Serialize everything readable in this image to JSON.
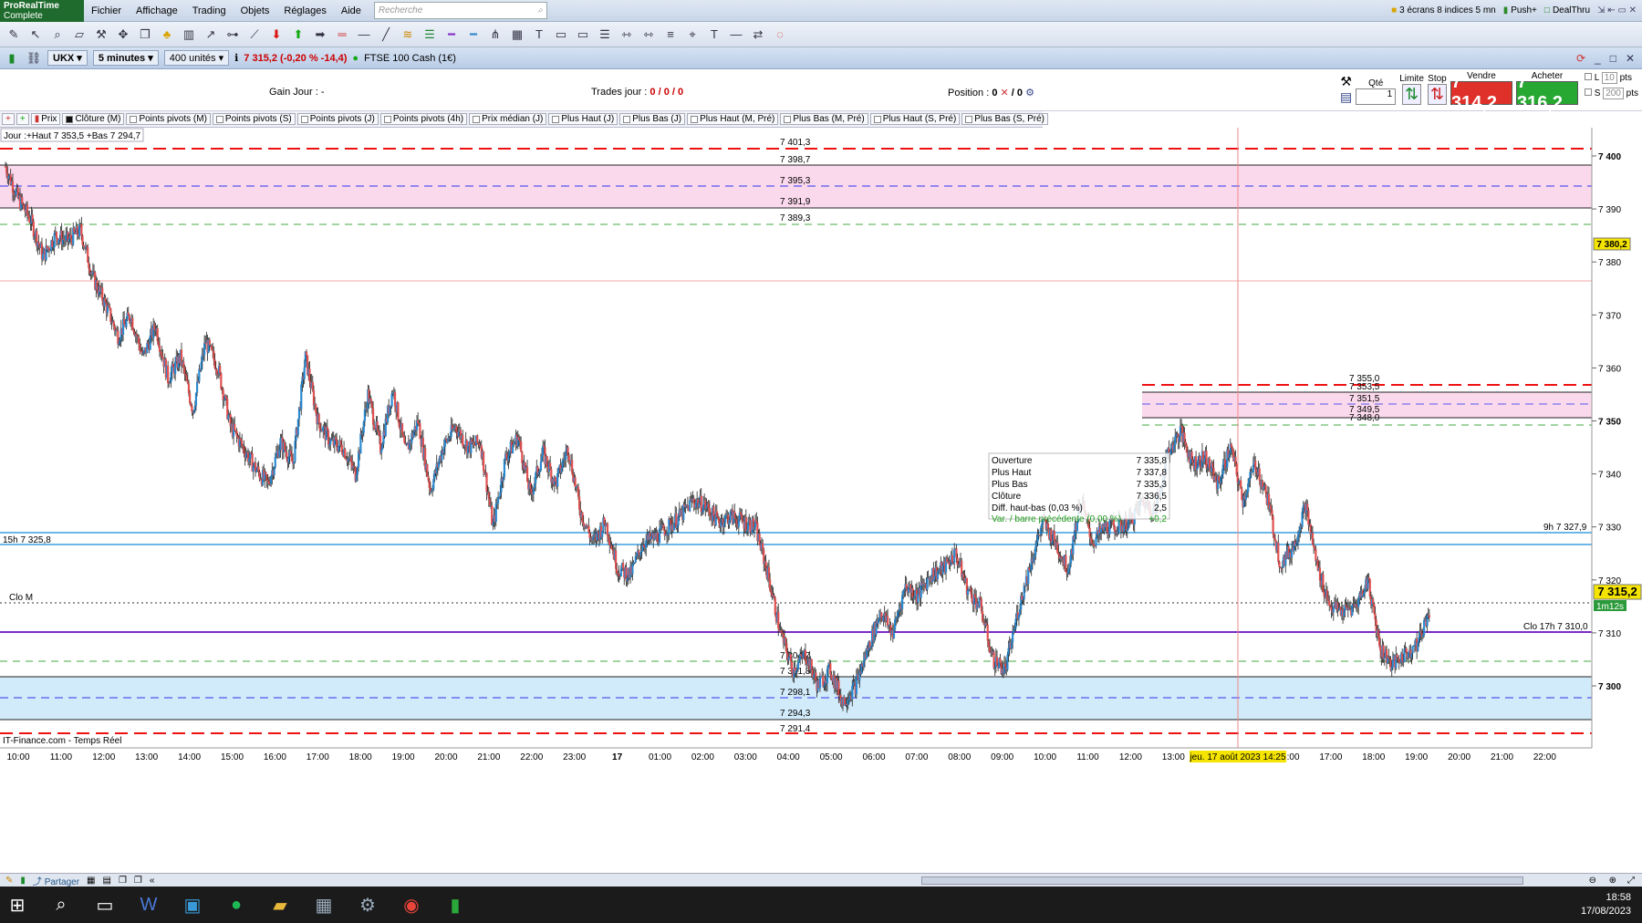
{
  "menubar": {
    "logo_line1": "ProRealTime",
    "logo_line2": "Complete",
    "items": [
      "Fichier",
      "Affichage",
      "Trading",
      "Objets",
      "Réglages",
      "Aide"
    ],
    "search_placeholder": "Recherche",
    "screens_label": "3 écrans 8 indices 5 mn",
    "push_label": "Push+",
    "dealthru_label": "DealThru"
  },
  "instrument": {
    "ticker": "UKX",
    "timeframe": "5 minutes",
    "units": "400 unités",
    "price_info": "7 315,2 (-0,20 % -14,4)",
    "name": "FTSE 100 Cash (1€)"
  },
  "tradebar": {
    "gain_label": "Gain Jour : -",
    "trades_label": "Trades jour :",
    "trades_value": "0 / 0 / 0",
    "position_label": "Position :",
    "position_value": "0",
    "position_value2": "/ 0",
    "qty_label": "Qté",
    "qty_value": "1",
    "limit_label": "Limite",
    "stop_label": "Stop",
    "sell_label": "Vendre",
    "buy_label": "Acheter",
    "sell_price": "7 314,2",
    "buy_price": "7 316,2",
    "l_label": "L",
    "l_value": "10",
    "s_label": "S",
    "s_value": "200",
    "pts": "pts"
  },
  "indicators": [
    "Prix",
    "Clôture (M)",
    "Points pivots (M)",
    "Points pivots (S)",
    "Points pivots (J)",
    "Points pivots (4h)",
    "Prix médian (J)",
    "Plus Haut (J)",
    "Plus Bas (J)",
    "Plus Haut (M, Pré)",
    "Plus Bas (M, Pré)",
    "Plus Haut (S, Pré)",
    "Plus Bas (S, Pré)"
  ],
  "chart": {
    "day_info": "Jour :+Haut 7 353,5 +Bas 7 294,7",
    "level_15h": "15h 7 325,8",
    "level_9h": "9h 7 327,9",
    "clo_m": "Clo M",
    "clo_17h": "Clo 17h 7 310,0",
    "price_tag": "7 315,2",
    "timer_tag": "1m12s",
    "alert_tag": "7 380,2",
    "crosshair_label": "jeu. 17 août 2023 14:25",
    "source": "IT-Finance.com - Temps Réel",
    "y_ticks": [
      "7 400",
      "7 390",
      "7 380",
      "7 370",
      "7 360",
      "7 350",
      "7 340",
      "7 330",
      "7 320",
      "7 310",
      "7 300"
    ],
    "x_ticks": [
      "10:00",
      "11:00",
      "12:00",
      "13:00",
      "14:00",
      "15:00",
      "16:00",
      "17:00",
      "18:00",
      "19:00",
      "20:00",
      "21:00",
      "22:00",
      "23:00",
      "17",
      "01:00",
      "02:00",
      "03:00",
      "04:00",
      "05:00",
      "06:00",
      "07:00",
      "08:00",
      "09:00",
      "10:00",
      "11:00",
      "12:00",
      "13:00",
      "15:00",
      "16:00",
      "17:00",
      "18:00",
      "19:00",
      "20:00",
      "21:00",
      "22:00"
    ],
    "levels_left": [
      "7 401,3",
      "7 398,7",
      "7 395,3",
      "7 391,9",
      "7 389,3"
    ],
    "levels_left_bottom": [
      "7 304,7",
      "7 301,8",
      "7 298,1",
      "7 294,3",
      "7 291,4"
    ],
    "levels_right": [
      "7 355,0",
      "7 353,5",
      "7 351,5",
      "7 349,5",
      "7 348,0"
    ],
    "tooltip": {
      "rows": [
        [
          "Ouverture",
          "7 335,8"
        ],
        [
          "Plus Haut",
          "7 337,8"
        ],
        [
          "Plus Bas",
          "7 335,3"
        ],
        [
          "Clôture",
          "7 336,5"
        ],
        [
          "Diff. haut-bas (0,03 %)",
          "2,5"
        ],
        [
          "Var. / barre précédente (0,00 %)",
          "+0,2"
        ]
      ]
    }
  },
  "bottombar": {
    "share_label": "Partager"
  },
  "taskbar": {
    "time": "18:58",
    "date": "17/08/2023"
  },
  "chart_data": {
    "type": "candlestick",
    "ylim": [
      7291,
      7404
    ],
    "close_path": [
      7398,
      7392,
      7388,
      7381,
      7385,
      7384,
      7386,
      7377,
      7372,
      7366,
      7370,
      7362,
      7368,
      7358,
      7362,
      7352,
      7365,
      7360,
      7349,
      7345,
      7341,
      7338,
      7346,
      7342,
      7362,
      7350,
      7346,
      7345,
      7340,
      7355,
      7345,
      7356,
      7344,
      7350,
      7337,
      7345,
      7349,
      7345,
      7346,
      7330,
      7343,
      7347,
      7336,
      7344,
      7338,
      7345,
      7333,
      7327,
      7331,
      7322,
      7321,
      7327,
      7328,
      7330,
      7332,
      7335,
      7334,
      7331,
      7332,
      7331,
      7330,
      7321,
      7310,
      7303,
      7306,
      7300,
      7303,
      7297,
      7300,
      7307,
      7314,
      7310,
      7319,
      7317,
      7321,
      7322,
      7325,
      7318,
      7315,
      7305,
      7303,
      7314,
      7323,
      7331,
      7327,
      7322,
      7335,
      7327,
      7330,
      7330,
      7331,
      7335,
      7333,
      7344,
      7348,
      7342,
      7343,
      7338,
      7345,
      7335,
      7342,
      7335,
      7323,
      7326,
      7334,
      7322,
      7315,
      7314,
      7315,
      7320,
      7307,
      7304,
      7306,
      7308,
      7315
    ]
  }
}
